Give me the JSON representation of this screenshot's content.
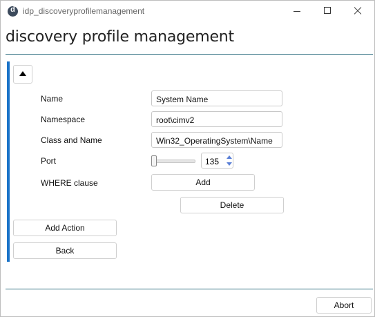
{
  "window": {
    "title": "idp_discoveryprofilemanagement"
  },
  "header": {
    "title": "discovery profile management"
  },
  "form": {
    "name_label": "Name",
    "name_value": "System Name",
    "namespace_label": "Namespace",
    "namespace_value": "root\\cimv2",
    "class_label": "Class and Name",
    "class_value": "Win32_OperatingSystem\\Name",
    "port_label": "Port",
    "port_value": "135",
    "where_label": "WHERE clause",
    "add_label": "Add",
    "delete_label": "Delete"
  },
  "actions": {
    "add_action_label": "Add Action",
    "back_label": "Back"
  },
  "footer": {
    "abort_label": "Abort"
  },
  "colors": {
    "accent_bar": "#1a73c8",
    "divider": "#2f6f80",
    "spinner_arrow": "#5a7fd6"
  }
}
